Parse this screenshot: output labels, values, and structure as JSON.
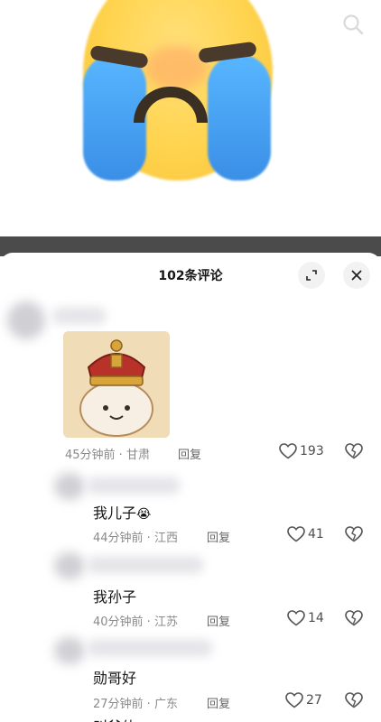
{
  "sheet": {
    "title": "102条评论"
  },
  "comments": [
    {
      "time": "45分钟前 · 甘肃",
      "reply": "回复",
      "likes": "193"
    },
    {
      "text": "我儿子",
      "emoji": "😭",
      "time": "44分钟前 · 江西",
      "reply": "回复",
      "likes": "41"
    },
    {
      "text": "我孙子",
      "time": "40分钟前 · 江苏",
      "reply": "回复",
      "likes": "14"
    },
    {
      "text": "勋哥好",
      "time": "27分钟前 · 广东",
      "reply": "回复",
      "likes": "27"
    },
    {
      "text": "叫爸体"
    }
  ]
}
